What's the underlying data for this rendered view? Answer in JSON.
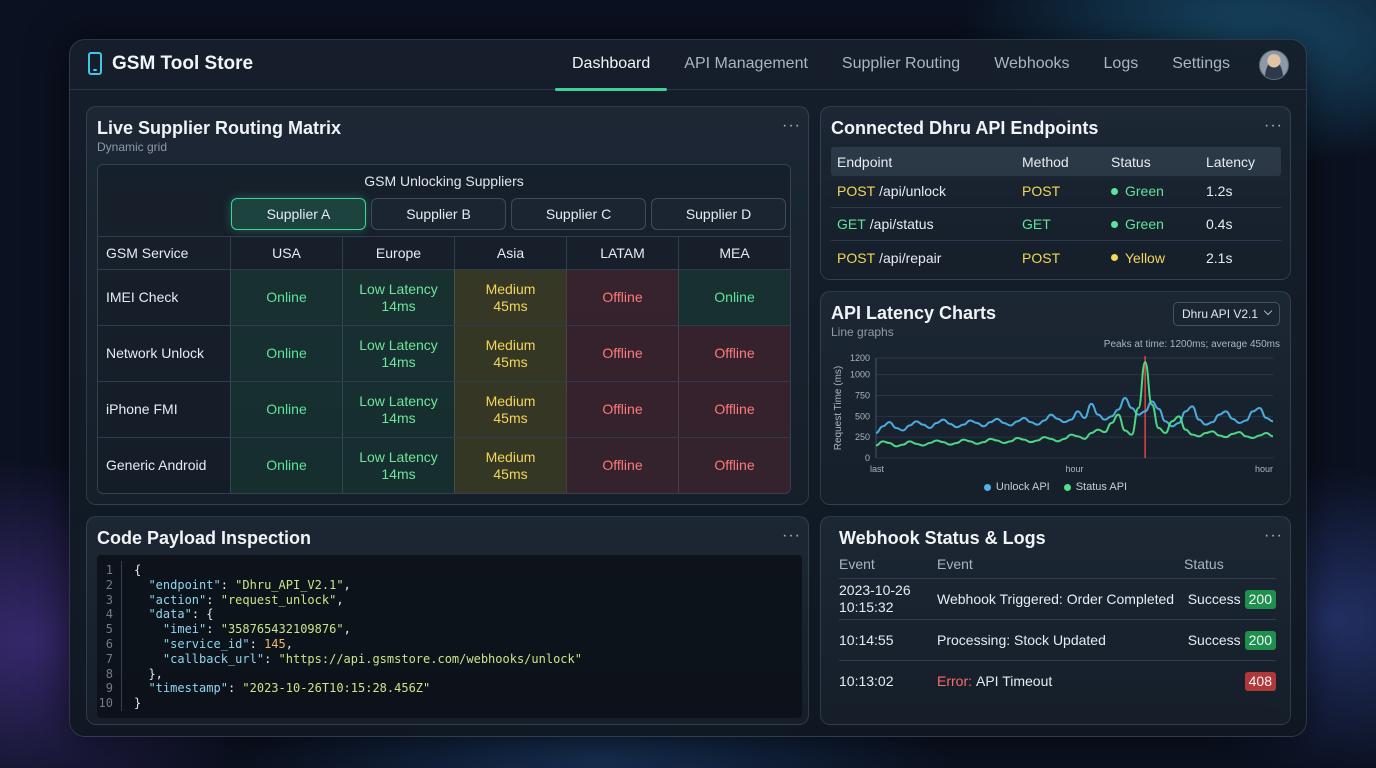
{
  "app": {
    "name": "GSM Tool Store"
  },
  "nav": {
    "tabs": [
      {
        "label": "Dashboard",
        "active": true
      },
      {
        "label": "API Management",
        "active": false
      },
      {
        "label": "Supplier Routing",
        "active": false
      },
      {
        "label": "Webhooks",
        "active": false
      },
      {
        "label": "Logs",
        "active": false
      },
      {
        "label": "Settings",
        "active": false
      }
    ]
  },
  "routing": {
    "title": "Live Supplier Routing Matrix",
    "subtitle": "Dynamic grid",
    "more": "···",
    "group_label": "GSM Unlocking Suppliers",
    "suppliers": [
      "Supplier A",
      "Supplier B",
      "Supplier C",
      "Supplier D"
    ],
    "active_supplier": "Supplier A",
    "service_header": "GSM Service",
    "regions": [
      "USA",
      "Europe",
      "Asia",
      "LATAM",
      "MEA"
    ],
    "rows": [
      {
        "service": "IMEI Check",
        "cells": [
          {
            "status": "online",
            "line1": "Online",
            "line2": ""
          },
          {
            "status": "low",
            "line1": "Low Latency",
            "line2": "14ms"
          },
          {
            "status": "medium",
            "line1": "Medium",
            "line2": "45ms"
          },
          {
            "status": "offline",
            "line1": "Offline",
            "line2": ""
          },
          {
            "status": "online",
            "line1": "Online",
            "line2": ""
          }
        ]
      },
      {
        "service": "Network Unlock",
        "cells": [
          {
            "status": "online",
            "line1": "Online",
            "line2": ""
          },
          {
            "status": "low",
            "line1": "Low Latency",
            "line2": "14ms"
          },
          {
            "status": "medium",
            "line1": "Medium",
            "line2": "45ms"
          },
          {
            "status": "offline",
            "line1": "Offline",
            "line2": ""
          },
          {
            "status": "offline",
            "line1": "Offline",
            "line2": ""
          }
        ]
      },
      {
        "service": "iPhone FMI",
        "cells": [
          {
            "status": "online",
            "line1": "Online",
            "line2": ""
          },
          {
            "status": "low",
            "line1": "Low Latency",
            "line2": "14ms"
          },
          {
            "status": "medium",
            "line1": "Medium",
            "line2": "45ms"
          },
          {
            "status": "offline",
            "line1": "Offline",
            "line2": ""
          },
          {
            "status": "offline",
            "line1": "Offline",
            "line2": ""
          }
        ]
      },
      {
        "service": "Generic Android",
        "cells": [
          {
            "status": "online",
            "line1": "Online",
            "line2": ""
          },
          {
            "status": "low",
            "line1": "Low Latency",
            "line2": "14ms"
          },
          {
            "status": "medium",
            "line1": "Medium",
            "line2": "45ms"
          },
          {
            "status": "offline",
            "line1": "Offline",
            "line2": ""
          },
          {
            "status": "offline",
            "line1": "Offline",
            "line2": ""
          }
        ]
      }
    ]
  },
  "endpoints": {
    "title": "Connected Dhru API Endpoints",
    "more": "···",
    "headers": [
      "Endpoint",
      "Method",
      "Status",
      "Latency"
    ],
    "rows": [
      {
        "method_prefix": "POST",
        "path": "/api/unlock",
        "method": "POST",
        "status": "Green",
        "latency": "1.2s",
        "color": "#5fe39a"
      },
      {
        "method_prefix": "GET",
        "path": "/api/status",
        "method": "GET",
        "status": "Green",
        "latency": "0.4s",
        "color": "#5fe39a"
      },
      {
        "method_prefix": "POST",
        "path": "/api/repair",
        "method": "POST",
        "status": "Yellow",
        "latency": "2.1s",
        "color": "#f2d75a"
      }
    ]
  },
  "latency": {
    "title": "API Latency Charts",
    "subtitle": "Line graphs",
    "selected_api": "Dhru API V2.1",
    "note": "Peaks at time: 1200ms; average 450ms"
  },
  "chart_data": {
    "type": "line",
    "ylabel": "Request Time (ms)",
    "yticks": [
      0,
      250,
      500,
      750,
      1000,
      1200
    ],
    "ylim": [
      0,
      1200
    ],
    "xticks": [
      "last",
      "hour",
      "hour"
    ],
    "x": [
      0,
      1,
      2,
      3,
      4,
      5,
      6,
      7,
      8,
      9,
      10,
      11,
      12,
      13,
      14,
      15,
      16,
      17,
      18,
      19,
      20,
      21,
      22,
      23,
      24,
      25,
      26,
      27,
      28,
      29,
      30,
      31,
      32,
      33,
      34,
      35,
      36,
      37,
      38,
      39,
      40,
      41,
      42,
      43,
      44,
      45,
      46,
      47,
      48,
      49,
      50,
      51,
      52,
      53,
      54,
      55,
      56,
      57,
      58,
      59
    ],
    "series": [
      {
        "name": "Unlock API",
        "color": "#4fb3e8",
        "values": [
          300,
          380,
          430,
          360,
          330,
          390,
          440,
          400,
          360,
          420,
          460,
          410,
          370,
          400,
          450,
          420,
          380,
          430,
          470,
          420,
          390,
          440,
          480,
          430,
          400,
          450,
          520,
          470,
          430,
          460,
          560,
          480,
          650,
          520,
          460,
          500,
          580,
          720,
          600,
          520,
          560,
          680,
          590,
          440,
          380,
          420,
          560,
          620,
          460,
          400,
          430,
          520,
          560,
          470,
          420,
          450,
          560,
          600,
          480,
          440
        ]
      },
      {
        "name": "Status API",
        "color": "#4fe08a",
        "values": [
          150,
          200,
          180,
          140,
          160,
          200,
          170,
          150,
          180,
          210,
          190,
          160,
          180,
          220,
          200,
          170,
          190,
          230,
          210,
          180,
          200,
          240,
          220,
          190,
          210,
          250,
          230,
          200,
          230,
          280,
          260,
          230,
          300,
          340,
          310,
          420,
          520,
          330,
          280,
          600,
          1150,
          640,
          360,
          300,
          440,
          500,
          340,
          280,
          260,
          300,
          320,
          270,
          250,
          290,
          310,
          260,
          240,
          270,
          300,
          260
        ]
      }
    ],
    "peak": {
      "x": 40,
      "value": 1200
    },
    "legend": "bottom"
  },
  "code": {
    "title": "Code Payload Inspection",
    "more": "···",
    "lines": [
      "{",
      "  \"endpoint\": \"Dhru_API_V2.1\",",
      "  \"action\": \"request_unlock\",",
      "  \"data\": {",
      "    \"imei\": \"358765432109876\",",
      "    \"service_id\": 145,",
      "    \"callback_url\": \"https://api.gsmstore.com/webhooks/unlock\"",
      "  },",
      "  \"timestamp\": \"2023-10-26T10:15:28.456Z\"",
      "}"
    ]
  },
  "webhooks": {
    "title": "Webhook Status & Logs",
    "more": "···",
    "headers": [
      "Event",
      "Event",
      "Status"
    ],
    "rows": [
      {
        "time": "2023-10-26\n10:15:32",
        "error_prefix": "",
        "event": "Webhook Triggered: Order Completed",
        "status_text": "Success",
        "code": "200",
        "kind": "ok"
      },
      {
        "time": "10:14:55",
        "error_prefix": "",
        "event": "Processing: Stock Updated",
        "status_text": "Success",
        "code": "200",
        "kind": "ok"
      },
      {
        "time": "10:13:02",
        "error_prefix": "Error:",
        "event": "API Timeout",
        "status_text": "",
        "code": "408",
        "kind": "err"
      }
    ]
  }
}
